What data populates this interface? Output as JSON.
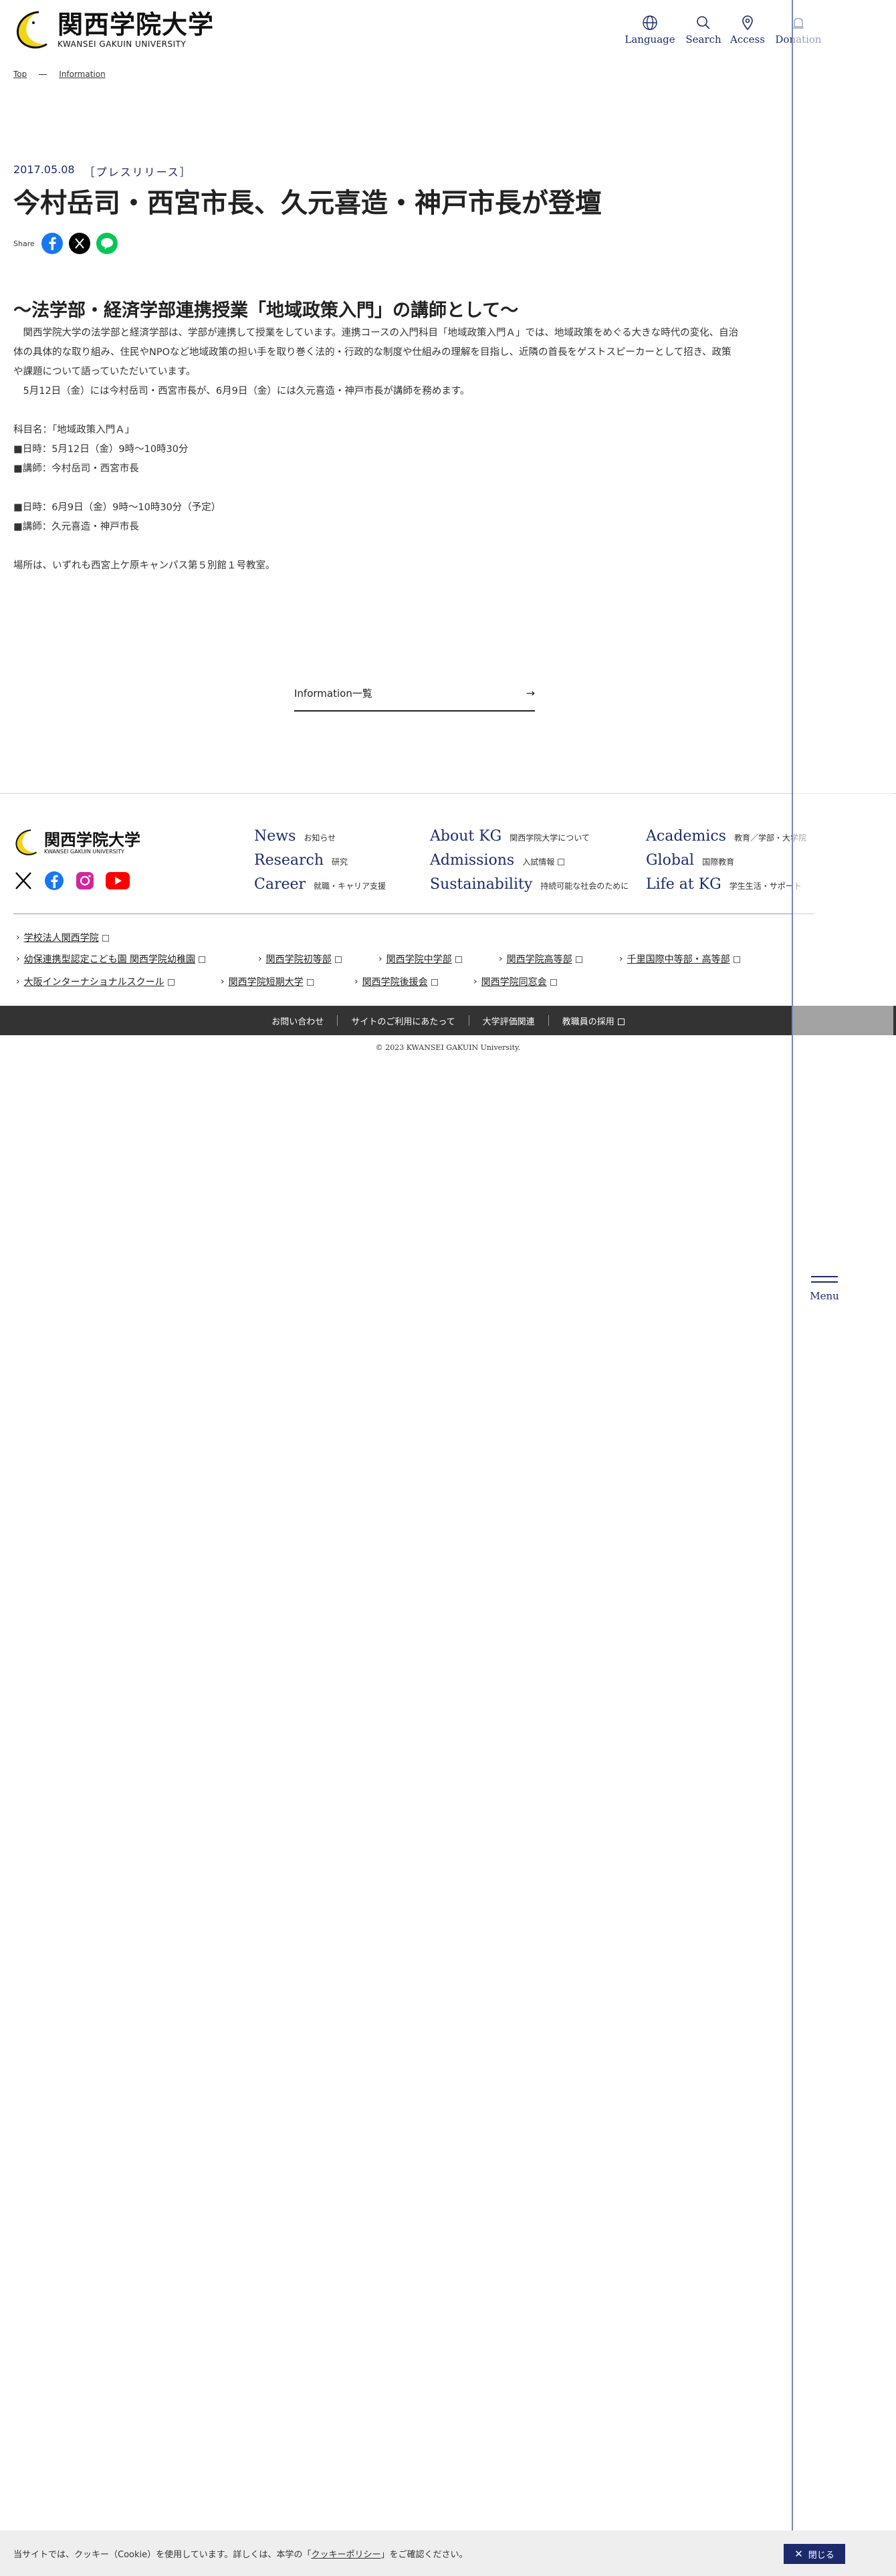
{
  "header": {
    "logo_jp": "関西学院大学",
    "logo_en": "KWANSEI GAKUIN UNIVERSITY",
    "nav": [
      {
        "label": "Language",
        "icon": "globe-icon"
      },
      {
        "label": "Search",
        "icon": "search-icon"
      },
      {
        "label": "Access",
        "icon": "map-pin-icon"
      },
      {
        "label": "Donation",
        "icon": "donation-icon"
      }
    ]
  },
  "breadcrumb": [
    "Top",
    "Information"
  ],
  "article": {
    "date": "2017.05.08",
    "category": "［プレスリリース］",
    "title": "今村岳司・西宮市長、久元喜造・神戸市長が登壇",
    "share_label": "Share",
    "share_icons": [
      "facebook-icon",
      "x-icon",
      "line-icon"
    ],
    "subtitle": "〜法学部・経済学部連携授業「地域政策入門」の講師として〜",
    "body": [
      "　関西学院大学の法学部と経済学部は、学部が連携して授業をしています。連携コースの入門科目「地域政策入門Ａ」では、地域政策をめぐる大きな時代の変化、自治",
      "体の具体的な取り組み、住民やNPOなど地域政策の担い手を取り巻く法的・行政的な制度や仕組みの理解を目指し、近隣の首長をゲストスピーカーとして招き、政策",
      "や課題について語っていただいています。",
      "　5月12日（金）には今村岳司・西宮市長が、6月9日（金）には久元喜造・神戸市長が講師を務めます。",
      "",
      "科目名：「地域政策入門Ａ」",
      "■日時：5月12日（金）9時〜10時30分",
      "■講師：今村岳司・西宮市長",
      "",
      "■日時：6月9日（金）9時〜10時30分（予定）",
      "■講師：久元喜造・神戸市長",
      "",
      "場所は、いずれも西宮上ケ原キャンパス第５別館１号教室。"
    ],
    "list_button": "Information一覧"
  },
  "footer": {
    "logo_jp": "関西学院大学",
    "logo_en": "KWANSEI GAKUIN UNIVERSITY",
    "social": [
      "x-icon",
      "facebook-icon",
      "instagram-icon",
      "youtube-icon"
    ],
    "nav": [
      {
        "en": "News",
        "jp": "お知らせ",
        "ext": false
      },
      {
        "en": "Research",
        "jp": "研究",
        "ext": false
      },
      {
        "en": "Career",
        "jp": "就職・キャリア支援",
        "ext": false
      },
      {
        "en": "About KG",
        "jp": "関西学院大学について",
        "ext": false
      },
      {
        "en": "Admissions",
        "jp": "入試情報",
        "ext": true
      },
      {
        "en": "Sustainability",
        "jp": "持続可能な社会のために",
        "ext": false
      },
      {
        "en": "Academics",
        "jp": "教育／学部・大学院",
        "ext": false
      },
      {
        "en": "Global",
        "jp": "国際教育",
        "ext": false
      },
      {
        "en": "Life at KG",
        "jp": "学生生活・サポート",
        "ext": false
      }
    ],
    "related": [
      "学校法人関西学院",
      "幼保連携型認定こども園 関西学院幼稚園",
      "関西学院初等部",
      "関西学院中学部",
      "関西学院高等部",
      "千里国際中等部・高等部",
      "大阪インターナショナルスクール",
      "関西学院短期大学",
      "関西学院後援会",
      "関西学院同窓会"
    ],
    "bar_links": [
      "お問い合わせ",
      "サイトのご利用にあたって",
      "大学評価関連",
      "教職員の採用"
    ],
    "copyright": "© 2023 KWANSEI GAKUIN University."
  },
  "menu_label": "Menu",
  "cookie": {
    "msg_before": "当サイトでは、クッキー（Cookie）を使用しています。詳しくは、本学の「",
    "msg_link": "クッキーポリシー",
    "msg_after": "」をご確認ください。",
    "close_label": "閉じる"
  },
  "colors": {
    "accent": "#1c2a6b",
    "logo_yellow": "#f3d318",
    "footer_bar": "#333333"
  }
}
